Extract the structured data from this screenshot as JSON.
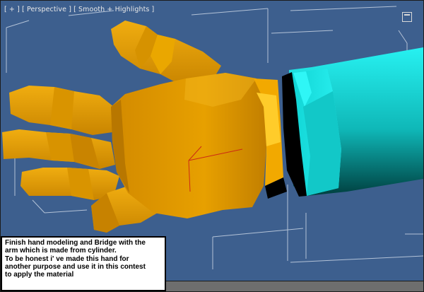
{
  "viewport": {
    "label": "[ + ] [ Perspective ] [ Smooth + Highlights ]",
    "background": "#3d5f8e"
  },
  "scene": {
    "hand_color": "#e39a00",
    "wrist_highlight": "#ffcc2a",
    "arm_color": "#19e6e6",
    "arm_end_color": "#004a4a"
  },
  "caption": {
    "lines": [
      "Finish hand modeling and Bridge with the",
      "arm which is made from cylinder.",
      "To be honest i' ve made this hand for",
      "another purpose and use it in this contest",
      "to apply the material"
    ]
  },
  "icons": {
    "maximize": "maximize-icon"
  }
}
